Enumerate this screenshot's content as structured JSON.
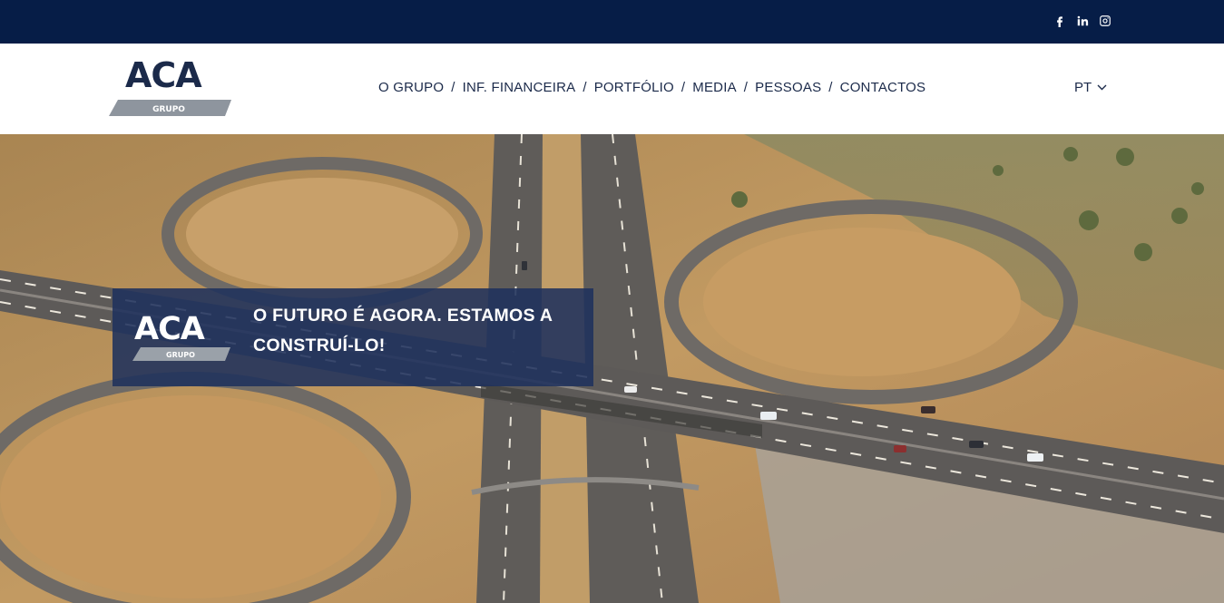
{
  "topbar": {
    "social": [
      {
        "icon": "facebook-icon",
        "label": "f"
      },
      {
        "icon": "linkedin-icon",
        "label": "in"
      },
      {
        "icon": "instagram-icon",
        "label": ""
      }
    ],
    "background": "#061d47"
  },
  "header": {
    "logo": {
      "text": "ACA",
      "subtext": "GRUPO"
    },
    "nav": [
      "O GRUPO",
      "INF. FINANCEIRA",
      "PORTFÓLIO",
      "MEDIA",
      "PESSOAS",
      "CONTACTOS"
    ],
    "separator": "/",
    "language": "PT"
  },
  "hero": {
    "banner_logo": {
      "text": "ACA",
      "subtext": "GRUPO"
    },
    "headline": "O FUTURO É AGORA. ESTAMOS A CONSTRUÍ-LO!"
  },
  "colors": {
    "navy": "#061d47",
    "banner": "#1f315c",
    "logo_gray": "#8e959e",
    "text_dark": "#1b2a4a"
  }
}
